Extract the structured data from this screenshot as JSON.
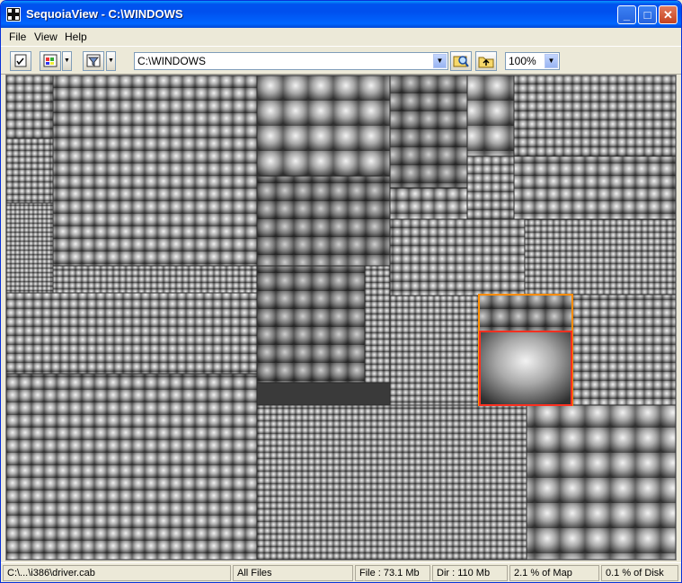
{
  "window": {
    "title": "SequoiaView - C:\\WINDOWS"
  },
  "menu": {
    "file": "File",
    "view": "View",
    "help": "Help"
  },
  "toolbar": {
    "address": "C:\\WINDOWS",
    "zoom": "100%"
  },
  "icons": [
    "app-icon",
    "options-icon",
    "color-scheme-icon",
    "filter-icon",
    "dropdown-arrow-icon",
    "browse-icon",
    "folder-up-icon"
  ],
  "status": {
    "path": "C:\\...\\i386\\driver.cab",
    "filter": "All Files",
    "file_size": "File : 73.1 Mb",
    "dir_size": "Dir : 110 Mb",
    "pct_map": "2.1 % of Map",
    "pct_disk": "0.1 % of Disk"
  },
  "colors": {
    "title_bar": "#0055ea",
    "selected_dir": "#ff8c00",
    "selected_file": "#ff3020"
  }
}
